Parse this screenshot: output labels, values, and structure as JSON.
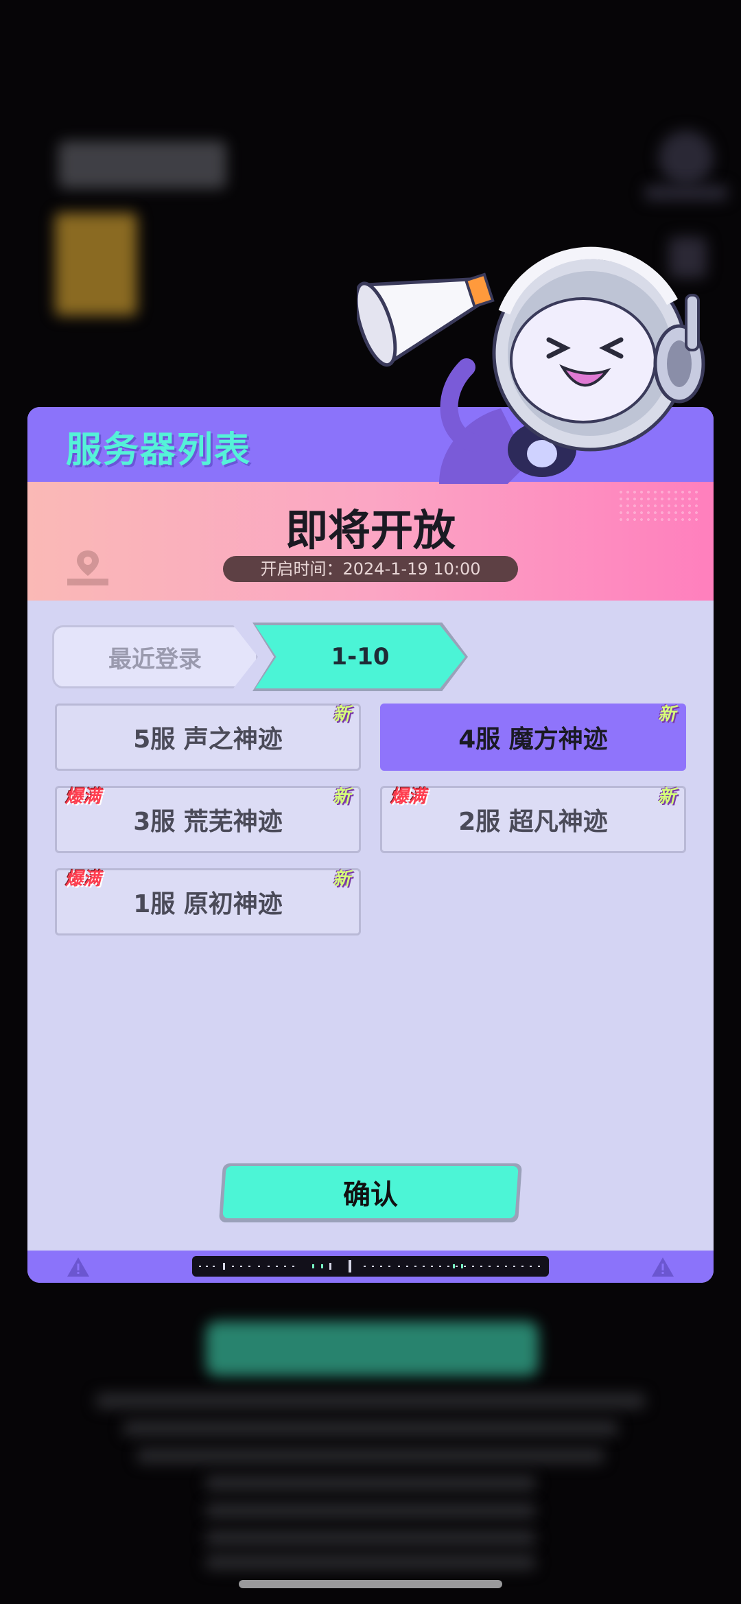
{
  "dialog": {
    "title": "服务器列表",
    "banner": {
      "title": "即将开放",
      "open_time": "开启时间：2024-1-19 10:00"
    },
    "tabs": [
      {
        "label": "最近登录",
        "active": false
      },
      {
        "label": "1-10",
        "active": true
      }
    ],
    "servers": [
      {
        "label": "5服 声之神迹",
        "new_badge": "新",
        "full_badge": "",
        "selected": false
      },
      {
        "label": "4服 魔方神迹",
        "new_badge": "新",
        "full_badge": "",
        "selected": true
      },
      {
        "label": "3服 荒芜神迹",
        "new_badge": "新",
        "full_badge": "爆满",
        "selected": false
      },
      {
        "label": "2服 超凡神迹",
        "new_badge": "新",
        "full_badge": "爆满",
        "selected": false
      },
      {
        "label": "1服 原初神迹",
        "new_badge": "新",
        "full_badge": "爆满",
        "selected": false
      }
    ],
    "confirm_label": "确认"
  },
  "colors": {
    "header": "#8b73fa",
    "title_text": "#55f2d8",
    "accent": "#4bf4d6",
    "selected": "#8f74fb",
    "panel": "#d4d4f3"
  },
  "icons": [
    "megaphone-mascot",
    "warning-icon"
  ]
}
